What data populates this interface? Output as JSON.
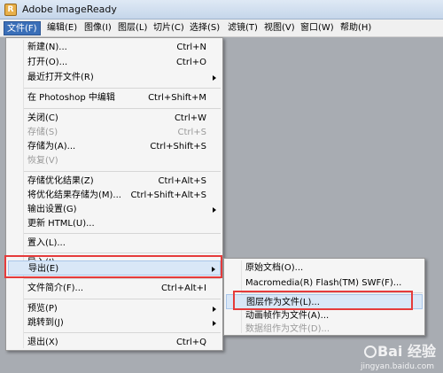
{
  "window": {
    "title": "Adobe ImageReady",
    "icon": "imageready-app-icon"
  },
  "menubar": [
    "文件(F)",
    "编辑(E)",
    "图像(I)",
    "图层(L)",
    "切片(C)",
    "选择(S)",
    "滤镜(T)",
    "视图(V)",
    "窗口(W)",
    "帮助(H)"
  ],
  "file_menu": [
    {
      "label": "新建(N)...",
      "shortcut": "Ctrl+N"
    },
    {
      "label": "打开(O)...",
      "shortcut": "Ctrl+O"
    },
    {
      "label": "最近打开文件(R)",
      "shortcut": "",
      "submenu": true
    },
    {
      "label": "在 Photoshop 中编辑",
      "shortcut": "Ctrl+Shift+M"
    },
    {
      "label": "关闭(C)",
      "shortcut": "Ctrl+W"
    },
    {
      "label": "存储(S)",
      "shortcut": "Ctrl+S",
      "disabled": true
    },
    {
      "label": "存储为(A)...",
      "shortcut": "Ctrl+Shift+S"
    },
    {
      "label": "恢复(V)",
      "shortcut": "",
      "disabled": true
    },
    {
      "label": "存储优化结果(Z)",
      "shortcut": "Ctrl+Alt+S"
    },
    {
      "label": "将优化结果存储为(M)...",
      "shortcut": "Ctrl+Shift+Alt+S"
    },
    {
      "label": "输出设置(G)",
      "shortcut": "",
      "submenu": true
    },
    {
      "label": "更新 HTML(U)...",
      "shortcut": ""
    },
    {
      "label": "置入(L)...",
      "shortcut": ""
    },
    {
      "label": "导入(I)",
      "shortcut": "",
      "submenu": true
    },
    {
      "label": "导出(E)",
      "shortcut": "",
      "submenu": true,
      "highlight": true
    },
    {
      "label": "文件简介(F)...",
      "shortcut": "Ctrl+Alt+I"
    },
    {
      "label": "预览(P)",
      "shortcut": "",
      "submenu": true
    },
    {
      "label": "跳转到(J)",
      "shortcut": "",
      "submenu": true
    },
    {
      "label": "退出(X)",
      "shortcut": "Ctrl+Q"
    }
  ],
  "export_submenu": [
    {
      "label": "原始文档(O)...",
      "disabled": false
    },
    {
      "label": "Macromedia(R) Flash(TM) SWF(F)...",
      "disabled": false
    },
    {
      "label": "图层作为文件(L)...",
      "disabled": false,
      "highlight": true
    },
    {
      "label": "动画帧作为文件(A)...",
      "disabled": false
    },
    {
      "label": "数据组作为文件(D)...",
      "disabled": true
    }
  ],
  "watermark": {
    "text": "Bai  经验",
    "sub": "jingyan.baidu.com"
  },
  "colors": {
    "highlight_box": "#e53b3b",
    "menu_active": "#3a6fb8"
  }
}
